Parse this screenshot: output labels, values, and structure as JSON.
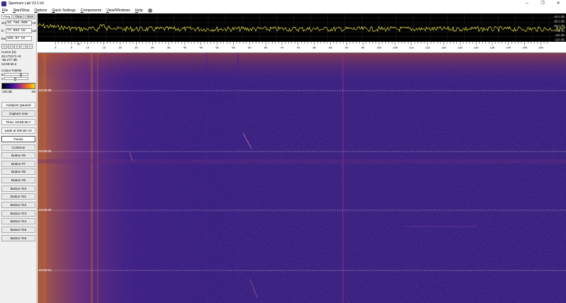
{
  "window": {
    "title": "Spectrum Lab V3.1 b3",
    "minimize": "─",
    "maximize": "❐",
    "close": "✕"
  },
  "menu": [
    {
      "first": "F",
      "rest": "ile"
    },
    {
      "first": "S",
      "rest": "tart/Stop"
    },
    {
      "first": "O",
      "rest": "ptions"
    },
    {
      "first": "Q",
      "rest": "uick Settings"
    },
    {
      "first": "C",
      "rest": "omponents"
    },
    {
      "first": "V",
      "rest": "iew/Windows"
    },
    {
      "first": "H",
      "rest": "elp"
    }
  ],
  "left": {
    "tabs": [
      "Freq",
      "Time",
      "RDF"
    ],
    "vfo": {
      "label": "vfo",
      "value": "10 768.000",
      "unit": "Hz"
    },
    "fc": {
      "label": "fc",
      "value": "77.963  Hz",
      "unit": "opt"
    },
    "bw": {
      "label": "bw",
      "value": "155.97  Hz",
      "unit": ""
    },
    "nav": [
      "«",
      "<",
      "»",
      "-",
      "+"
    ],
    "cursor": {
      "title": "Cursor [H]",
      "freq": "28.173171 Hz",
      "level": "-86.277 dB",
      "time": "04:00:50.2"
    },
    "palette": {
      "title": "Colour Palette",
      "b_label": "B",
      "c_label": "C",
      "scale_min": "-100 dB",
      "scale_max": "-50"
    },
    "buttons": {
      "analyzer": "Analyzer paused",
      "capture": "Capture now",
      "time": "Time:  18:58:26.7",
      "peak": "peak at 250.81 Hz",
      "pause": "Pause",
      "continue": "Continue",
      "b6": "Button #6",
      "b7": "Button #7",
      "b8": "Button #8",
      "b9": "Button #9",
      "b10": "Button #10",
      "b11": "Button #11",
      "b12": "Button #12",
      "b13": "Button #13",
      "b14": "Button #14",
      "b15": "Button #15",
      "b16": "Button #16"
    }
  },
  "spectrum": {
    "db_labels": [
      "-40.0 dB",
      "-60.0 dB",
      "-80.0 dB",
      "-100 dB",
      "-110 dB",
      "-120 dB"
    ],
    "trace_color": "#e8e84a"
  },
  "scale": {
    "labels": [
      "0",
      "5",
      "10",
      "15",
      "20",
      "25",
      "30",
      "35",
      "40",
      "45",
      "50",
      "55",
      "60",
      "65",
      "70",
      "75",
      "80",
      "85",
      "90",
      "95",
      "100",
      "105",
      "110",
      "115",
      "120",
      "125",
      "130",
      "135",
      "140",
      "145",
      "150"
    ],
    "unit": "Hz",
    "max_hz": 155
  },
  "waterfall": {
    "timestamps": [
      "04:00:05",
      "04:00:03",
      "04:00:03",
      "04:00:01"
    ],
    "colors": {
      "background": "#2a1676",
      "mid": "#4a1f8e",
      "hot": "#c0622a"
    }
  }
}
